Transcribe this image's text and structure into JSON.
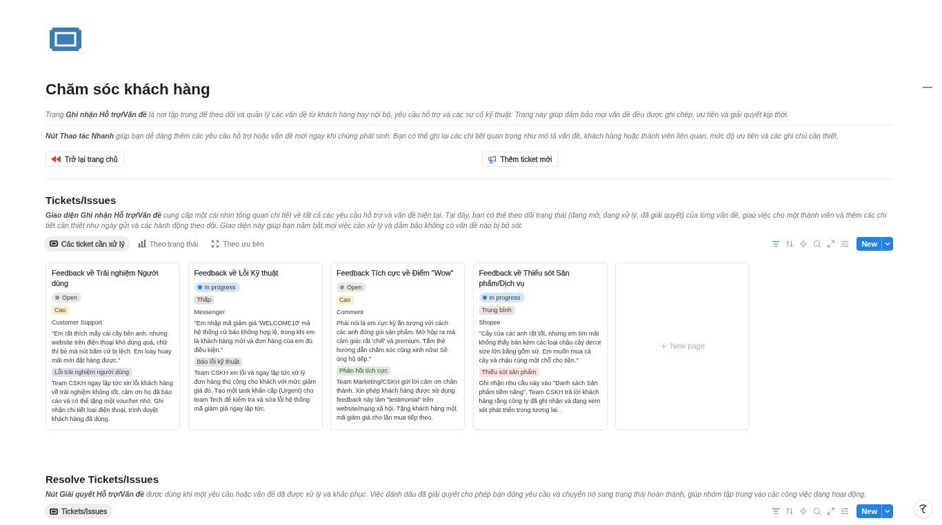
{
  "page": {
    "title": "Chăm sóc khách hàng",
    "intro": [
      "Trang **Ghi nhận Hỗ trợ/Vấn đề** là nơi tập trung để theo dõi và quản lý các vấn đề từ khách hàng hay nội bộ, yêu cầu hỗ trợ và các sự cố kỹ thuật. Trang này giúp đảm bảo mọi vấn đề đều được ghi chép, ưu tiên và giải quyết kịp thời.",
      "**Nút Thao tác Nhanh** giúp bạn dễ dàng thêm các yêu cầu hỗ trợ hoặc vấn đề mới ngay khi chúng phát sinh. Bạn có thể ghi lại các chi tiết quan trọng như mô tả vấn đề, khách hàng hoặc thành viên liên quan, mức độ ưu tiên và các ghi chú cần thiết."
    ],
    "buttons": [
      {
        "label": "Trở lại trang chủ"
      },
      {
        "label": "Thêm ticket mới"
      }
    ]
  },
  "sections": [
    {
      "heading": "Tickets/Issues",
      "description": "**Giao diện Ghi nhận Hỗ trợ/Vấn đề** cung cấp một cái nhìn tổng quan chi tiết về tất cả các yêu cầu hỗ trợ và vấn đề hiện tại. Tại đây, bạn có thể theo dõi trạng thái (đang mở, đang xử lý, đã giải quyết) của từng vấn đề, giao việc cho một thành viên và thêm các chi tiết cần thiết như ngày gửi và các hành động theo dõi. Giao diện này giúp bạn nắm bắt mọi việc cần xử lý và đảm bảo không có vấn đề nào bị bỏ sót.",
      "views": [
        {
          "label": "Các ticket cần xử lý",
          "selected": true
        },
        {
          "label": "Theo trạng thái",
          "selected": false
        },
        {
          "label": "Theo ưu tiên",
          "selected": false
        }
      ],
      "toolbar": {
        "filter_active": true,
        "new_button": "New"
      },
      "cards": [
        {
          "title": "Feedback về Trải nghiệm Người dùng",
          "status": {
            "label": "Open",
            "color": "#91918e"
          },
          "priority": {
            "label": "Cao",
            "color": "#fdecc8"
          },
          "channel": "Customer Support",
          "feedback": "\"Em rất thích mấy cái cây bên anh, nhưng website trên điện thoại khó dùng quá, chữ thì bé mà nút bấm cứ bị lệch. Em loay hoay mãi mới đặt hàng được.\"",
          "category": {
            "label": "Lỗi trải nghiệm người dùng",
            "color": "#e8deee"
          },
          "response": "Team CSKH ngay lập tức xin lỗi khách hàng về trải nghiệm không tốt, cảm ơn họ đã báo cáo và có thể tặng một voucher nhỏ. Ghi nhận chi tiết loại điện thoại, trình duyệt khách hàng đã dùng."
        },
        {
          "title": "Feedback về Lỗi Kỹ thuật",
          "status": {
            "label": "In progress",
            "color": "#2383e2"
          },
          "priority": {
            "label": "Thấp",
            "color": "#e3e2e0"
          },
          "channel": "Messenger",
          "feedback": "\"Em nhập mã giảm giá 'WELCOME10' mà hệ thống cứ báo không hợp lệ, trong khi em là khách hàng mới và đơn hàng của em đủ điều kiện.\"",
          "category": {
            "label": "Báo lỗi kỹ thuật",
            "color": "#e3e2e0"
          },
          "response": "Team CSKH xin lỗi và ngay lập tức xử lý đơn hàng thủ công cho khách với mức giảm giá đó. Tạo một task khẩn cấp (Urgent) cho team Tech để kiểm tra và sửa lỗi hệ thống mã giảm giá ngay lập tức."
        },
        {
          "title": "Feedback Tích cực về Điểm \"Wow\"",
          "status": {
            "label": "Open",
            "color": "#91918e"
          },
          "priority": {
            "label": "Cao",
            "color": "#fdecc8"
          },
          "channel": "Comment",
          "feedback": "Phải nói là em cực kỳ ấn tượng với cách các anh đóng gói sản phẩm. Mở hộp ra mà cảm giác rất 'chill' và premium. Tấm thẻ hướng dẫn chăm sóc cũng xinh nữa! Sẽ ủng hộ tiếp.\"",
          "category": {
            "label": "Phản hồi tích cực",
            "color": "#dbeddb"
          },
          "response": "Team Marketing/CSKH gửi lời cảm ơn chân thành. Xin phép khách hàng được sử dụng feedback này làm \"testimonial\" trên website/mạng xã hội. Tặng khách hàng một mã giảm giá cho lần mua tiếp theo."
        },
        {
          "title": "Feedback về Thiếu sót Sản phẩm/Dịch vụ",
          "status": {
            "label": "In progress",
            "color": "#2383e2"
          },
          "priority": {
            "label": "Trung bình",
            "color": "#eee0da"
          },
          "channel": "Shopee",
          "feedback": "\"Cây của các anh rất tốt, nhưng em tìm mãi không thấy bán kèm các loại chậu cây decor size lớn bằng gốm sứ. Em muốn mua cả cây và chậu cùng một chỗ cho tiện.\"",
          "category": {
            "label": "Thiếu sót sản phẩm",
            "color": "#ffe2dd"
          },
          "response": "Ghi nhận nhu cầu này vào \"Danh sách Sản phẩm tiềm năng\". Team CSKH trả lời khách hàng rằng công ty đã ghi nhận và đang xem xét phát triển trong tương lai."
        }
      ],
      "new_card": "New page"
    },
    {
      "heading": "Resolve Tickets/Issues",
      "description": "**Nút Giải quyết Hỗ trợ/Vấn đề** được dùng khi một yêu cầu hoặc vấn đề đã được xử lý và khắc phục. Việc đánh dấu đã giải quyết cho phép bạn đóng yêu cầu và chuyển nó sang trạng thái hoàn thành, giúp nhóm tập trung vào các công việc đang hoạt động.",
      "views": [
        {
          "label": "Tickets/Issues",
          "selected": true
        }
      ],
      "toolbar": {
        "filter_active": true,
        "new_button": "New"
      }
    }
  ]
}
